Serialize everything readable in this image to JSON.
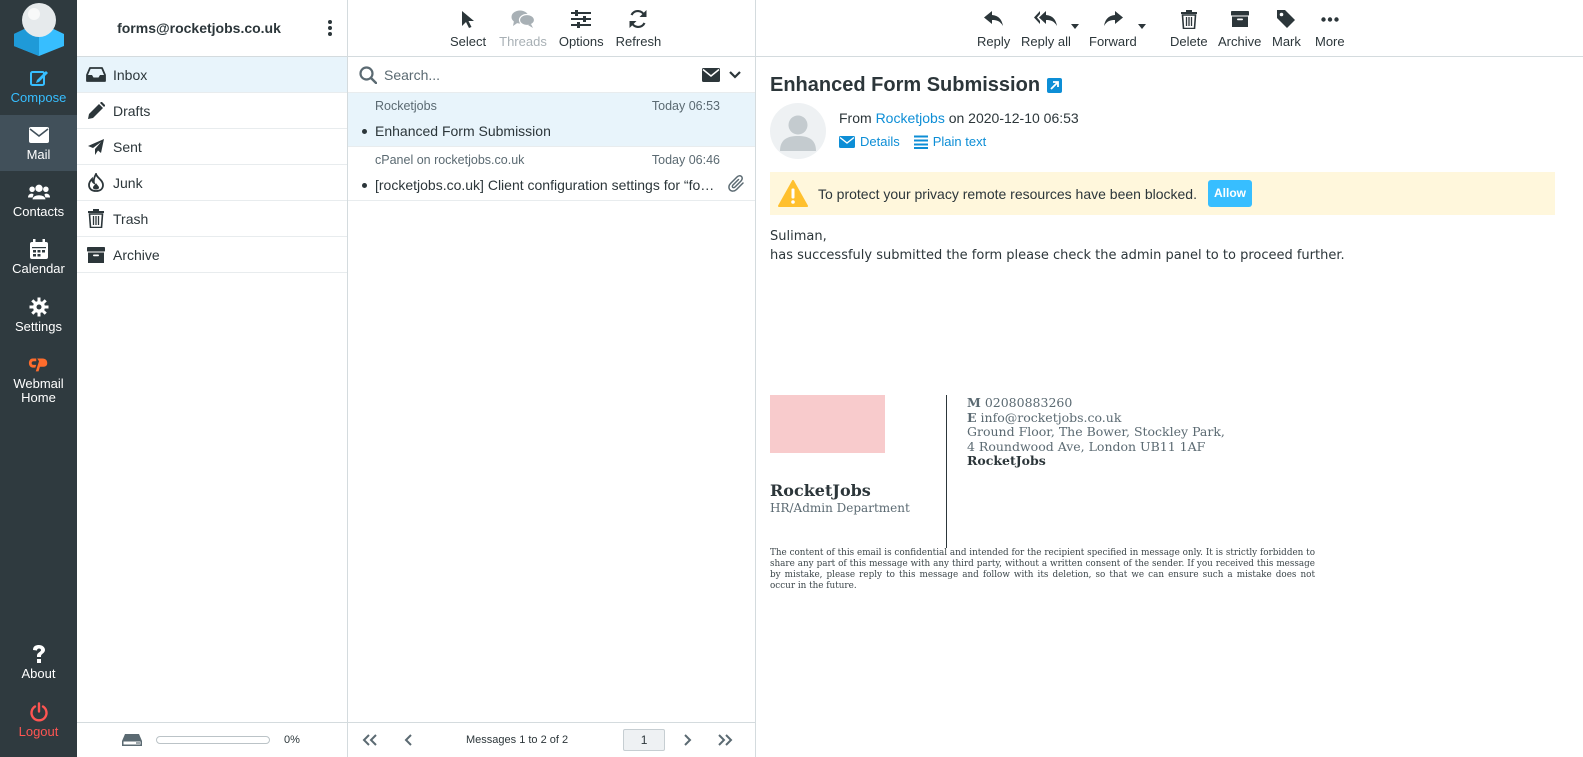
{
  "nav": {
    "compose": "Compose",
    "mail": "Mail",
    "contacts": "Contacts",
    "calendar": "Calendar",
    "settings": "Settings",
    "webmail_home_1": "Webmail",
    "webmail_home_2": "Home",
    "about": "About",
    "logout": "Logout"
  },
  "account": "forms@rocketjobs.co.uk",
  "folders": [
    {
      "label": "Inbox",
      "icon": "inbox-icon",
      "selected": true
    },
    {
      "label": "Drafts",
      "icon": "pencil-icon"
    },
    {
      "label": "Sent",
      "icon": "paper-plane-icon"
    },
    {
      "label": "Junk",
      "icon": "fire-icon"
    },
    {
      "label": "Trash",
      "icon": "trash-icon"
    },
    {
      "label": "Archive",
      "icon": "archive-icon"
    }
  ],
  "quota": {
    "percent_label": "0%",
    "used_fraction": 0
  },
  "list_toolbar": {
    "select": "Select",
    "threads": "Threads",
    "options": "Options",
    "refresh": "Refresh"
  },
  "search": {
    "placeholder": "Search..."
  },
  "messages": [
    {
      "from": "Rocketjobs",
      "date": "Today 06:53",
      "subject": "Enhanced Form Submission",
      "selected": true,
      "attachment": false
    },
    {
      "from": "cPanel on rocketjobs.co.uk",
      "date": "Today 06:46",
      "subject": "[rocketjobs.co.uk] Client configuration settings for “forms@rocketjobs.co.uk”",
      "selected": false,
      "attachment": true
    }
  ],
  "pager": {
    "status": "Messages 1 to 2 of 2",
    "page": "1"
  },
  "preview_toolbar": {
    "reply": "Reply",
    "reply_all": "Reply all",
    "forward": "Forward",
    "delete": "Delete",
    "archive": "Archive",
    "mark": "Mark",
    "more": "More"
  },
  "email": {
    "subject": "Enhanced Form Submission",
    "from_prefix": "From",
    "from_name": "Rocketjobs",
    "date_text": "on 2020-12-10 06:53",
    "details": "Details",
    "plain_text": "Plain text",
    "notice": "To protect your privacy remote resources have been blocked.",
    "allow": "Allow",
    "body_line1": "Suliman,",
    "body_line2": "has successfuly submitted the form please check the admin panel to to proceed further."
  },
  "signature": {
    "name": "RocketJobs",
    "department": "HR/Admin Department",
    "m_label": "M",
    "phone": "02080883260",
    "e_label": "E",
    "email": "info@rocketjobs.co.uk",
    "address1": "Ground Floor, The Bower, Stockley Park,",
    "address2": "4 Roundwood Ave, London UB11 1AF",
    "brand": "RocketJobs",
    "disclaimer": "The content of this email is confidential and intended for the recipient specified in message only. It is strictly forbidden to share any part of this message with any third party, without a written consent of the sender. If you received this message by mistake, please reply to this message and follow with its deletion, so that we can ensure such a mistake does not occur in the future."
  },
  "colors": {
    "nav_bg": "#2f3a3f",
    "accent": "#37beff",
    "link": "#0d8ed6",
    "logout": "#ff5552",
    "selected_row": "#e8f4fb",
    "notice_bg": "#fff7dc"
  }
}
